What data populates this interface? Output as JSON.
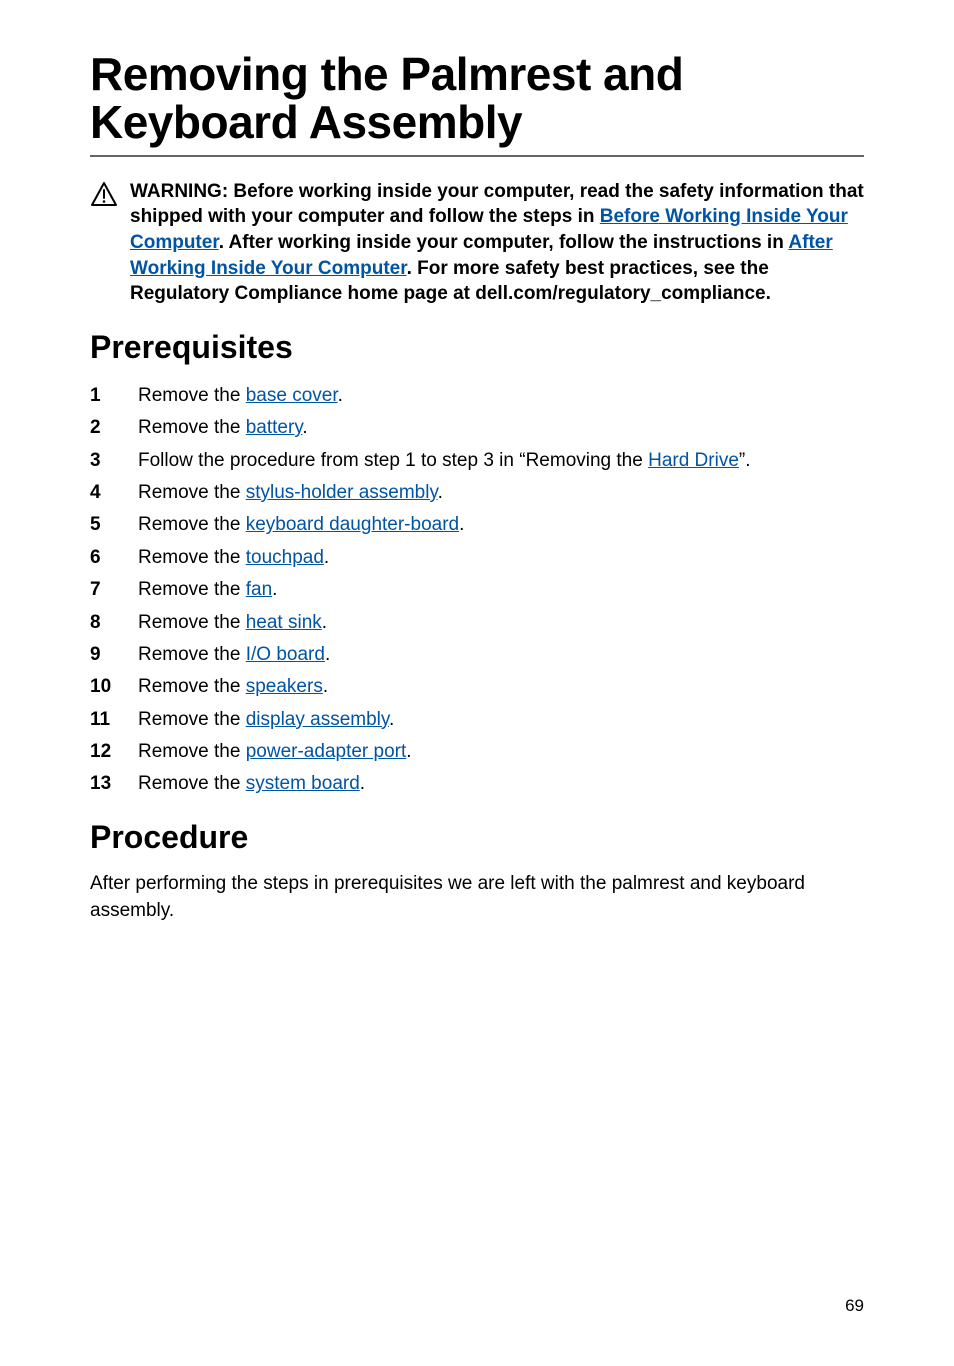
{
  "title": "Removing the Palmrest and Keyboard Assembly",
  "warning": {
    "parts": [
      "WARNING: Before working inside your computer, read the safety information that shipped with your computer and follow the steps in ",
      "Before Working Inside Your Computer",
      ". After working inside your computer, follow the instructions in ",
      "After Working Inside Your Computer",
      ". For more safety best practices, see the Regulatory Compliance home page at dell.com/regulatory_compliance."
    ]
  },
  "prereq_heading": "Prerequisites",
  "prereqs": [
    {
      "prefix": "Remove the ",
      "link": "base cover",
      "suffix": "."
    },
    {
      "prefix": "Remove the ",
      "link": "battery",
      "suffix": "."
    },
    {
      "prefix": "Follow the procedure from step 1 to step 3 in “Removing the ",
      "link": "Hard Drive",
      "suffix": "”."
    },
    {
      "prefix": "Remove the ",
      "link": "stylus-holder assembly",
      "suffix": "."
    },
    {
      "prefix": "Remove the ",
      "link": "keyboard daughter-board",
      "suffix": "."
    },
    {
      "prefix": "Remove the ",
      "link": "touchpad",
      "suffix": "."
    },
    {
      "prefix": "Remove the ",
      "link": "fan",
      "suffix": "."
    },
    {
      "prefix": "Remove the ",
      "link": "heat sink",
      "suffix": "."
    },
    {
      "prefix": "Remove the ",
      "link": "I/O board",
      "suffix": "."
    },
    {
      "prefix": "Remove the ",
      "link": "speakers",
      "suffix": "."
    },
    {
      "prefix": "Remove the ",
      "link": "display assembly",
      "suffix": "."
    },
    {
      "prefix": "Remove the ",
      "link": "power-adapter port",
      "suffix": "."
    },
    {
      "prefix": "Remove the ",
      "link": "system board",
      "suffix": "."
    }
  ],
  "procedure_heading": "Procedure",
  "procedure_text": "After performing the steps in prerequisites we are left with the palmrest and keyboard assembly.",
  "page_number": "69"
}
